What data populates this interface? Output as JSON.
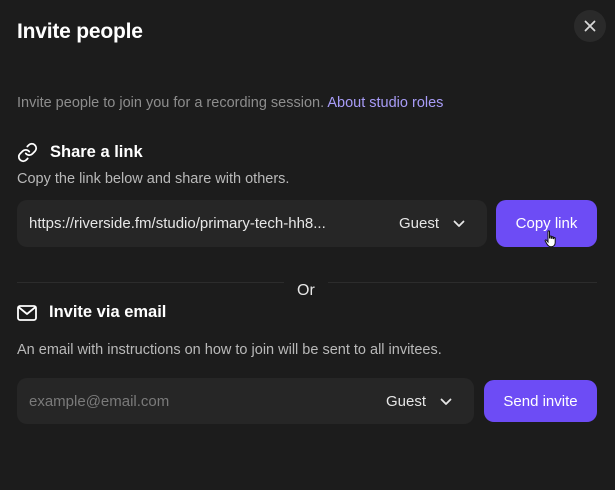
{
  "dialog": {
    "title": "Invite people",
    "close_icon": "close-icon"
  },
  "intro": {
    "text": "Invite people to join you for a recording session.",
    "link_label": "About studio roles"
  },
  "share": {
    "icon": "link-icon",
    "heading": "Share a link",
    "description": "Copy the link below and share with others.",
    "url": "https://riverside.fm/studio/primary-tech-hh8...",
    "role": "Guest",
    "button_label": "Copy link"
  },
  "separator": {
    "label": "Or"
  },
  "email": {
    "icon": "mail-icon",
    "heading": "Invite via email",
    "description": "An email with instructions on how to join will be sent to all invitees.",
    "placeholder": "example@email.com",
    "value": "",
    "role": "Guest",
    "button_label": "Send invite"
  },
  "colors": {
    "background": "#1c1c1c",
    "field": "#262626",
    "accent": "#6d4cf5",
    "link": "#a89cf7"
  }
}
